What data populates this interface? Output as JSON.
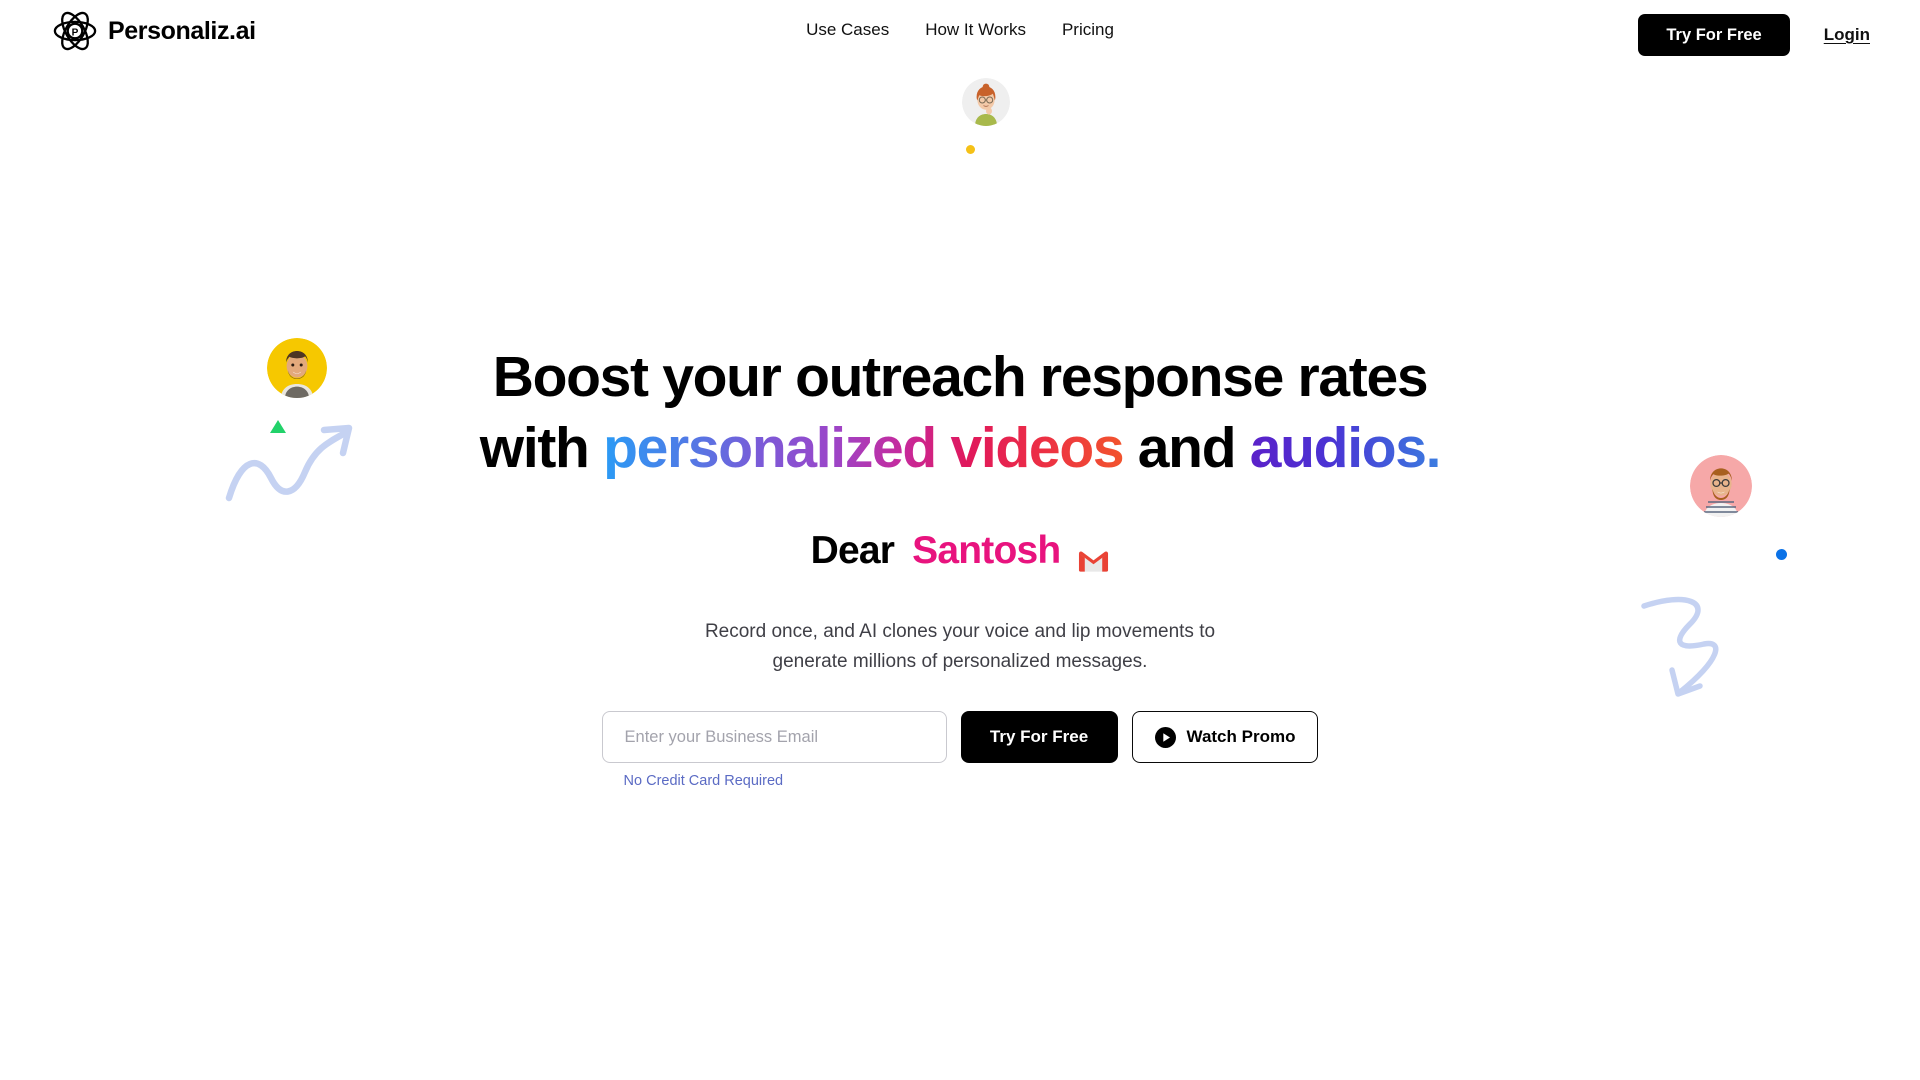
{
  "brand": {
    "name": "Personaliz.ai",
    "logo_icon": "atom-icon",
    "logo_letter": "P"
  },
  "nav": {
    "links": [
      {
        "label": "Use Cases",
        "name": "nav-link-use-cases"
      },
      {
        "label": "How It Works",
        "name": "nav-link-how-it-works"
      },
      {
        "label": "Pricing",
        "name": "nav-link-pricing"
      }
    ],
    "cta_label": "Try For Free",
    "login_label": "Login"
  },
  "hero": {
    "headline_line1": "Boost your outreach response rates",
    "headline_line2_pre": "with ",
    "headline_line2_gradient1": "personalized videos",
    "headline_line2_mid": " and ",
    "headline_line2_gradient2": "audios.",
    "greeting_word": "Dear",
    "greeting_name": "Santosh",
    "greeting_icon": "gmail-icon",
    "subtitle_line1": "Record once, and AI clones your voice and lip movements to",
    "subtitle_line2": "generate millions of personalized messages.",
    "email_placeholder": "Enter your Business Email",
    "email_value": "",
    "cta_primary_label": "Try For Free",
    "cta_secondary_label": "Watch Promo",
    "cta_secondary_icon": "play-icon",
    "disclaimer": "No Credit Card Required"
  },
  "decorations": {
    "avatar_top": "avatar-woman-glasses",
    "avatar_left": "avatar-man-yellow",
    "avatar_right": "avatar-man-pink",
    "dot_yellow": "#F5C117",
    "dot_blue": "#0B72E7",
    "triangle_green": "#22D26A",
    "squiggle_color": "#C5D2F2"
  },
  "colors": {
    "accent_pink": "#E8137E",
    "gradient_start": "#2B9BF5",
    "gradient_end": "#F2542D",
    "audios_start": "#5B21C9",
    "audios_end": "#3B7DE0",
    "disclaimer_blue": "#5B6BC4",
    "button_black": "#000000"
  }
}
